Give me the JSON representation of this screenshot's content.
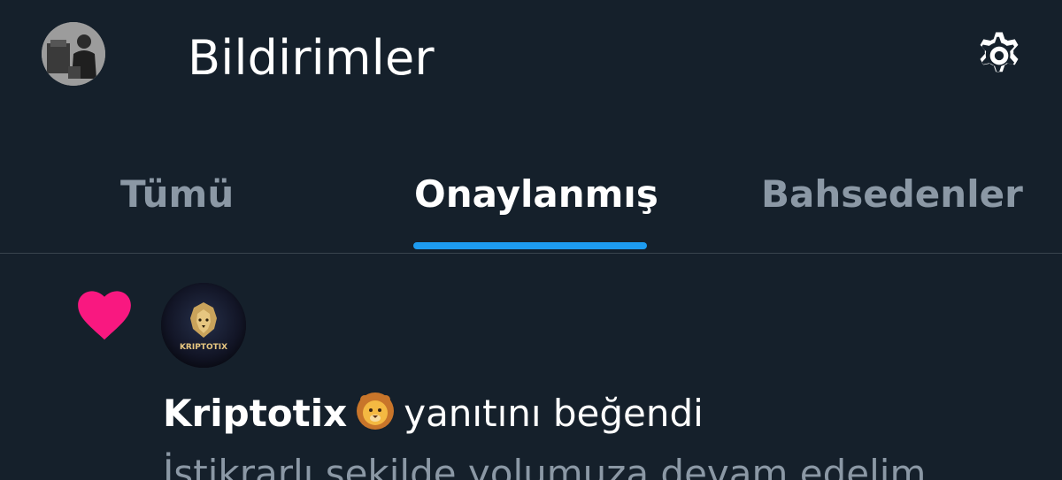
{
  "header": {
    "title": "Bildirimler",
    "avatar_icon": "profile-photo",
    "settings_icon": "gear-icon"
  },
  "tabs": [
    {
      "label": "Tümü",
      "active": false
    },
    {
      "label": "Onaylanmış",
      "active": true
    },
    {
      "label": "Bahsedenler",
      "active": false
    }
  ],
  "notification": {
    "type_icon": "heart-icon",
    "avatar_text": "KRIPTOTIX",
    "user_name": "Kriptotix",
    "user_emoji": "lion-face-emoji",
    "action": "yanıtını beğendi",
    "preview": "İstikrarlı şekilde yolumuza devam edelim"
  },
  "colors": {
    "background": "#15202b",
    "accent": "#1d9bf0",
    "like": "#f91880",
    "secondary_text": "#8b98a5",
    "divider": "#38444d"
  }
}
